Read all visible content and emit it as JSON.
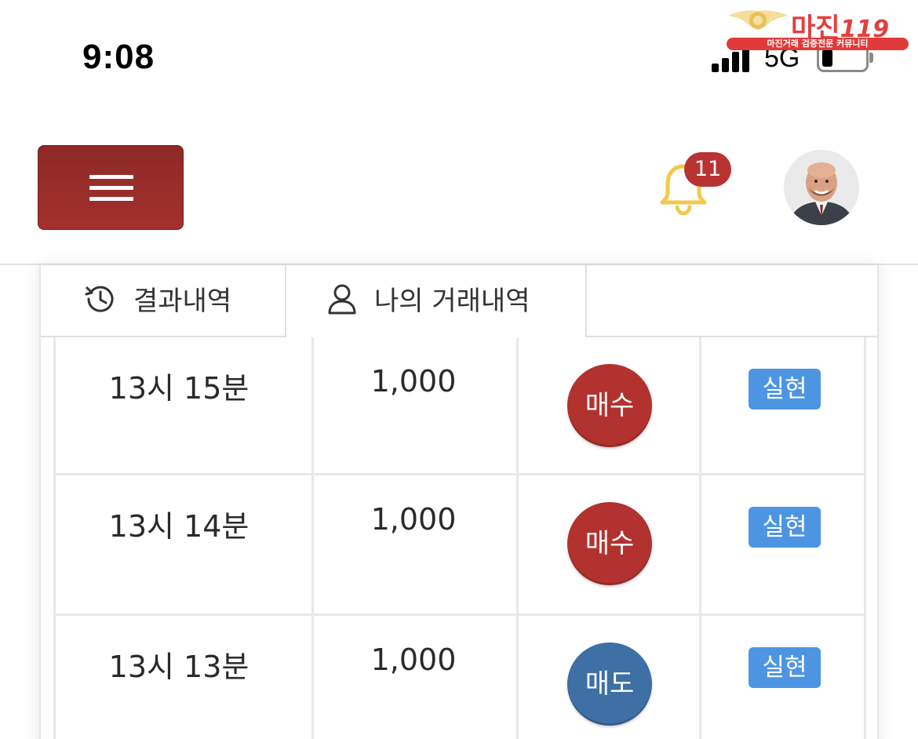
{
  "status_bar": {
    "time": "9:08",
    "network": "5G",
    "signal_bars": 4,
    "battery_percent": 18
  },
  "watermark": {
    "title": "마진",
    "number": "119",
    "subtitle": "마진거래 검증전문 커뮤니티",
    "color": "#e33f3f"
  },
  "header": {
    "menu_icon": "hamburger-menu-icon",
    "menu_color": "#9a2d2a",
    "bell_icon": "bell-icon",
    "bell_color": "#f2c94c",
    "notification_count": "11",
    "badge_color": "#b83331",
    "avatar": "user-avatar"
  },
  "tabs": [
    {
      "label": "결과내역",
      "icon": "history-clock-icon",
      "active": false
    },
    {
      "label": "나의 거래내역",
      "icon": "user-outline-icon",
      "active": true
    }
  ],
  "trades": [
    {
      "time": "13시 15분",
      "amount": "1,000",
      "side": "매수",
      "side_color": "#b2322f",
      "status": "실현",
      "status_color": "#4d95e2"
    },
    {
      "time": "13시 14분",
      "amount": "1,000",
      "side": "매수",
      "side_color": "#b2322f",
      "status": "실현",
      "status_color": "#4d95e2"
    },
    {
      "time": "13시 13분",
      "amount": "1,000",
      "side": "매도",
      "side_color": "#3e6fa5",
      "status": "실현",
      "status_color": "#4d95e2"
    }
  ]
}
